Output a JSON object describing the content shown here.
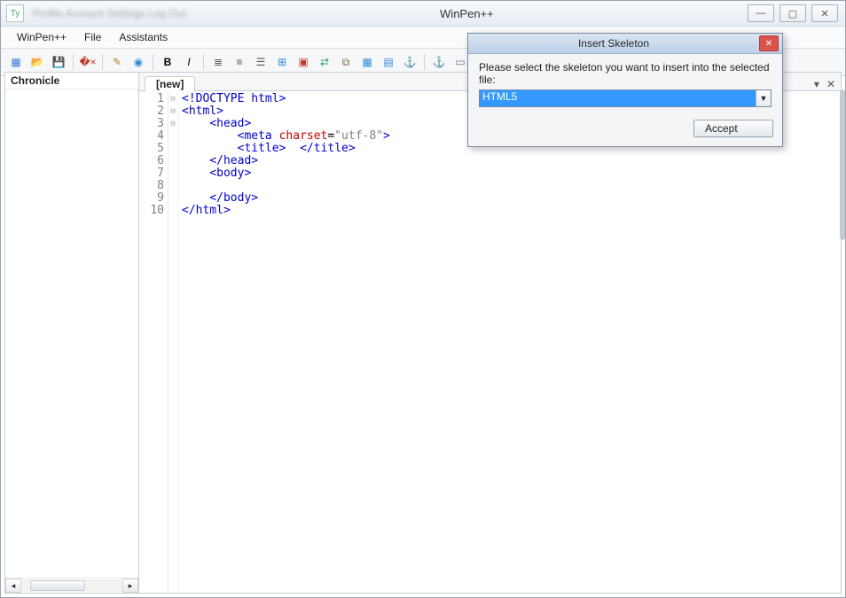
{
  "window": {
    "title": "WinPen++",
    "blur_text": "Profile   Account Settings   Log Out"
  },
  "menu": {
    "items": [
      "WinPen++",
      "File",
      "Assistants"
    ]
  },
  "toolbar_icons": [
    {
      "name": "new-file-icon",
      "glyph": "▦",
      "color": "#3a7bd5"
    },
    {
      "name": "open-file-icon",
      "glyph": "📂",
      "color": "#e2a23b"
    },
    {
      "name": "save-file-icon",
      "glyph": "💾",
      "color": "#3a7bd5"
    },
    {
      "name": "sep"
    },
    {
      "name": "close-tab-icon",
      "glyph": "�×",
      "color": "#c0392b"
    },
    {
      "name": "sep"
    },
    {
      "name": "edit-icon",
      "glyph": "✎",
      "color": "#c07d2b"
    },
    {
      "name": "globe-icon",
      "glyph": "◉",
      "color": "#2e8bd8"
    },
    {
      "name": "sep"
    },
    {
      "name": "bold-icon",
      "glyph": "B",
      "color": "#000",
      "bold": true
    },
    {
      "name": "italic-icon",
      "glyph": "I",
      "color": "#000",
      "italic": true
    },
    {
      "name": "sep"
    },
    {
      "name": "align-left-icon",
      "glyph": "≣",
      "color": "#555"
    },
    {
      "name": "align-center-icon",
      "glyph": "≡",
      "color": "#555"
    },
    {
      "name": "list-icon",
      "glyph": "☰",
      "color": "#555"
    },
    {
      "name": "insert-block-icon",
      "glyph": "⊞",
      "color": "#2e8bd8"
    },
    {
      "name": "image-icon",
      "glyph": "▣",
      "color": "#c0392b"
    },
    {
      "name": "exchange-icon",
      "glyph": "⇄",
      "color": "#2aa35a"
    },
    {
      "name": "link-icon",
      "glyph": "⧉",
      "color": "#7d6b3a"
    },
    {
      "name": "table-icon",
      "glyph": "▦",
      "color": "#2e8bd8"
    },
    {
      "name": "grid-icon",
      "glyph": "▤",
      "color": "#2e8bd8"
    },
    {
      "name": "anchor-icon",
      "glyph": "⚓",
      "color": "#6b7785"
    },
    {
      "name": "sep"
    },
    {
      "name": "anchor2-icon",
      "glyph": "⚓",
      "color": "#a9b2bb"
    },
    {
      "name": "form-icon",
      "glyph": "▭",
      "color": "#6b7785"
    }
  ],
  "sidebar": {
    "title": "Chronicle"
  },
  "tab": {
    "label": "[new]"
  },
  "tabrow_icons": {
    "dropdown": "▾",
    "close": "✕"
  },
  "code": {
    "lines": [
      {
        "n": 1,
        "fold": "",
        "html": "<span class='kw'>&lt;!DOCTYPE</span> <span class='kw'>html&gt;</span>"
      },
      {
        "n": 2,
        "fold": "⊟",
        "html": "<span class='kw'>&lt;html&gt;</span>"
      },
      {
        "n": 3,
        "fold": "⊟",
        "html": "    <span class='kw'>&lt;head&gt;</span>"
      },
      {
        "n": 4,
        "fold": "",
        "html": "        <span class='kw'>&lt;meta</span> <span class='attr'>charset</span>=<span class='str'>\"utf-8\"</span><span class='kw'>&gt;</span>"
      },
      {
        "n": 5,
        "fold": "",
        "html": "        <span class='kw'>&lt;title&gt;</span>  <span class='kw'>&lt;/title&gt;</span>"
      },
      {
        "n": 6,
        "fold": "",
        "html": "    <span class='kw'>&lt;/head&gt;</span>"
      },
      {
        "n": 7,
        "fold": "⊟",
        "html": "    <span class='kw'>&lt;body&gt;</span>"
      },
      {
        "n": 8,
        "fold": "",
        "html": ""
      },
      {
        "n": 9,
        "fold": "",
        "html": "    <span class='kw'>&lt;/body&gt;</span>"
      },
      {
        "n": 10,
        "fold": "",
        "html": "<span class='kw'>&lt;/html&gt;</span>"
      }
    ]
  },
  "dialog": {
    "title": "Insert Skeleton",
    "prompt": "Please select the skeleton you want to insert into the selected file:",
    "value": "HTML5",
    "accept": "Accept"
  }
}
